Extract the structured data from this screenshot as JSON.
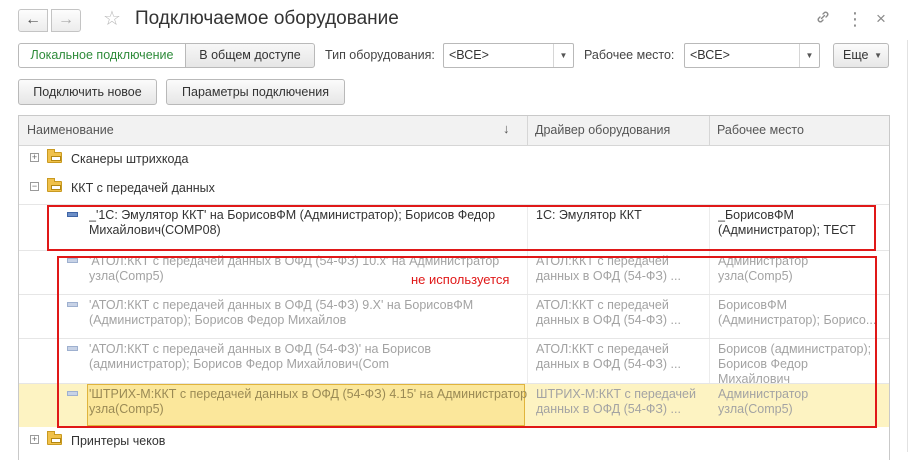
{
  "window": {
    "title": "Подключаемое оборудование",
    "back_glyph": "←",
    "forward_glyph": "→",
    "star_glyph": "☆",
    "link_glyph": "🔗",
    "menu_glyph": "⋮",
    "close_glyph": "×"
  },
  "toolbar": {
    "local_label": "Локальное подключение",
    "shared_label": "В общем доступе",
    "equipment_type_label": "Тип оборудования:",
    "equipment_type_value": "<ВСЕ>",
    "workplace_label": "Рабочее место:",
    "workplace_value": "<ВСЕ>",
    "more_label": "Еще",
    "connect_new_label": "Подключить новое",
    "connection_params_label": "Параметры подключения"
  },
  "table": {
    "columns": [
      "Наименование",
      "Драйвер оборудования",
      "Рабочее место"
    ],
    "sort_glyph": "↓",
    "groups": [
      {
        "label": "Сканеры штрихкода",
        "expander": "+"
      },
      {
        "label": "ККТ с передачей данных",
        "expander": "−"
      },
      {
        "label": "Принтеры чеков",
        "expander": "+"
      }
    ],
    "rows": [
      {
        "name": "_'1С: Эмулятор ККТ' на БорисовФМ (Администратор); Борисов Федор Михайлович(COMP08)",
        "driver": "1С: Эмулятор ККТ",
        "workplace": "_БорисовФМ (Администратор); ТЕСТ",
        "state": "active"
      },
      {
        "name": "'АТОЛ:ККТ с передачей данных в ОФД (54-ФЗ) 10.x' на Администратор узла(Comp5)",
        "driver": "АТОЛ:ККТ с передачей данных в ОФД (54-ФЗ) ...",
        "workplace": "Администратор узла(Comp5)",
        "state": "unused"
      },
      {
        "name": "'АТОЛ:ККТ с передачей данных в ОФД (54-ФЗ) 9.X' на БорисовФМ (Администратор); Борисов Федор Михайлов",
        "driver": "АТОЛ:ККТ с передачей данных в ОФД (54-ФЗ) ...",
        "workplace": "БорисовФМ (Администратор); Борисо...",
        "state": "unused"
      },
      {
        "name": "'АТОЛ:ККТ с передачей данных в ОФД (54-ФЗ)' на Борисов (администратор); Борисов Федор Михайлович(Com",
        "driver": "АТОЛ:ККТ с передачей данных в ОФД (54-ФЗ) ...",
        "workplace": "Борисов (администратор); Борисов Федор Михайлович",
        "state": "unused"
      },
      {
        "name": "'ШТРИХ-М:ККТ с передачей данных в ОФД (54-ФЗ) 4.15' на Администратор узла(Comp5)",
        "driver": "ШТРИХ-М:ККТ с передачей данных в ОФД (54-ФЗ) ...",
        "workplace": "Администратор узла(Comp5)",
        "state": "unused-selected"
      }
    ]
  },
  "annotation": {
    "unused_note": "не используется",
    "color": "#e01818"
  }
}
